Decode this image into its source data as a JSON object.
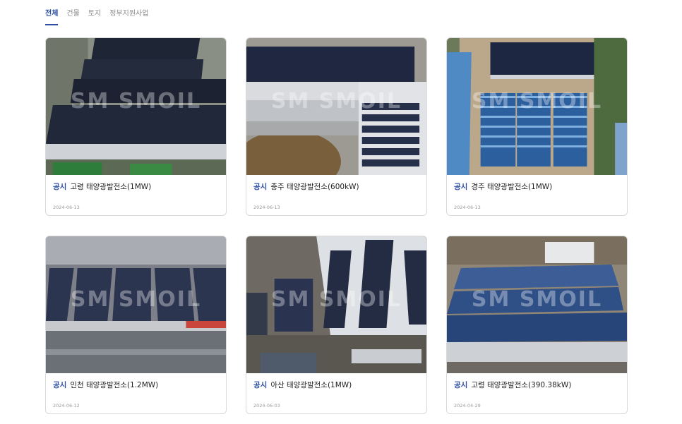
{
  "tabs": [
    {
      "label": "전체",
      "active": true
    },
    {
      "label": "건물",
      "active": false
    },
    {
      "label": "토지",
      "active": false
    },
    {
      "label": "정부지원사업",
      "active": false
    }
  ],
  "watermark": "SM SMOIL",
  "cards": [
    {
      "badge": "공시",
      "title": "고령 태양광발전소(1MW)",
      "date": "2024-06-13"
    },
    {
      "badge": "공시",
      "title": "충주 태양광발전소(600kW)",
      "date": "2024-06-13"
    },
    {
      "badge": "공시",
      "title": "경주 태양광발전소(1MW)",
      "date": "2024-06-13"
    },
    {
      "badge": "공시",
      "title": "인천 태양광발전소(1.2MW)",
      "date": "2024-06-12"
    },
    {
      "badge": "공시",
      "title": "아산 태양광발전소(1MW)",
      "date": "2024-06-03"
    },
    {
      "badge": "공시",
      "title": "고령 태양광발전소(390.38kW)",
      "date": "2024-04-29"
    }
  ],
  "colors": {
    "accent": "#2c4ea3",
    "panel": "#1f2a44",
    "roof": "#c9ccd1"
  }
}
